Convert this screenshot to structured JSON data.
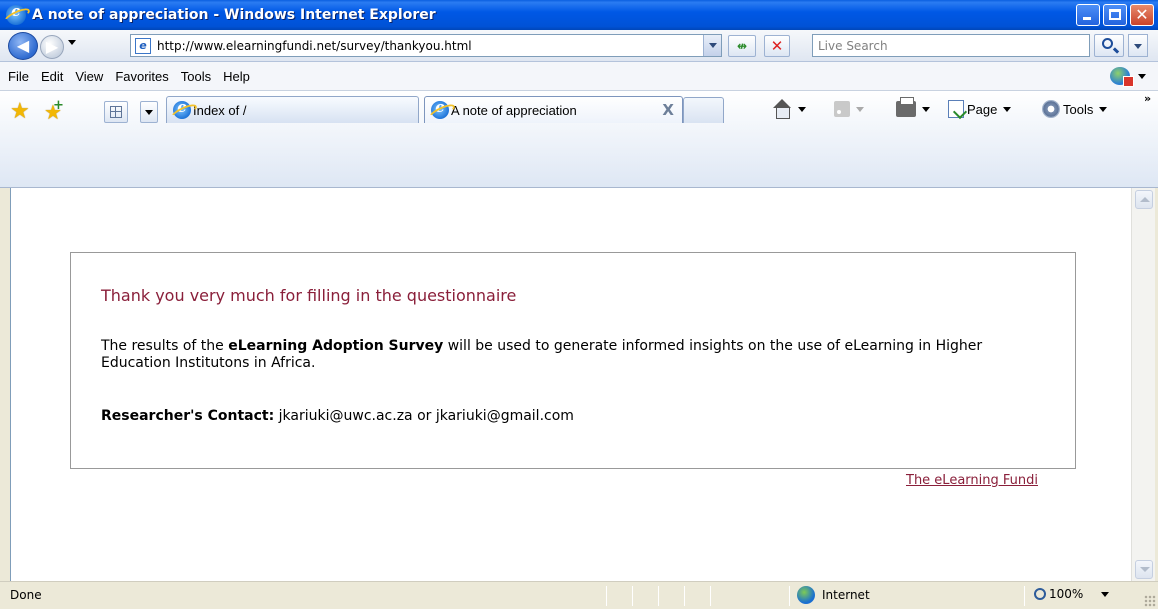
{
  "window": {
    "title": "A note of appreciation - Windows Internet Explorer"
  },
  "address_bar": {
    "url": "http://www.elearningfundi.net/survey/thankyou.html",
    "search_placeholder": "Live Search"
  },
  "menu": {
    "items": [
      "File",
      "Edit",
      "View",
      "Favorites",
      "Tools",
      "Help"
    ]
  },
  "tabs": [
    {
      "label": "Index of /",
      "active": false
    },
    {
      "label": "A note of appreciation",
      "active": true,
      "close": "X"
    }
  ],
  "command_bar": {
    "page_label": "Page",
    "tools_label": "Tools",
    "more": "»"
  },
  "content": {
    "heading": "Thank you very much for filling in the questionnaire",
    "para_pre": "The results of the ",
    "para_bold": "eLearning Adoption Survey",
    "para_post": " will be used to generate informed insights on the use of eLearning in Higher Education Institutons in Africa.",
    "contact_label": "Researcher's Contact:",
    "contact_value": " jkariuki@uwc.ac.za or jkariuki@gmail.com",
    "footer_link": "The eLearning Fundi"
  },
  "status_bar": {
    "status": "Done",
    "zone": "Internet",
    "zoom": "100%"
  },
  "colors": {
    "heading": "#8a1f3a",
    "titlebar": "#0058e6"
  }
}
